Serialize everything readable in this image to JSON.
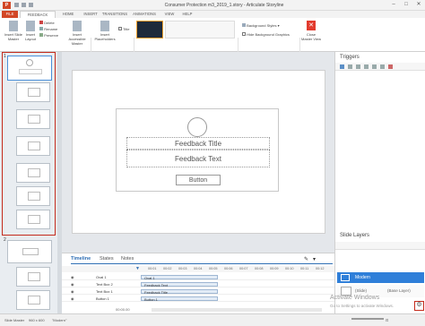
{
  "app": {
    "logo": "P",
    "window_title": "Consumer Protection m3_2019_1.story - Articulate Storyline",
    "min": "–",
    "max": "□",
    "close": "✕"
  },
  "tabs": [
    "FILE",
    "FEEDBACK MASTER",
    "HOME",
    "INSERT",
    "TRANSITIONS",
    "ANIMATIONS",
    "VIEW",
    "HELP"
  ],
  "ribbon": {
    "insert_slide_master": "Insert Slide Master",
    "insert_layout": "Insert Layout",
    "delete": "Delete",
    "rename": "Rename",
    "preserve": "Preserve",
    "insert_placeholder": "Insert Placeholders",
    "title": "Title",
    "insert_accessible_master": "Insert Accessible Master",
    "background_styles": "Background Styles",
    "hide_background_graphics": "Hide Background Graphics",
    "close_master_view": "Close Master View",
    "groups": {
      "edit_master": "Edit Master",
      "master_layout": "Master Layout",
      "theme_preview": "Theme Preview",
      "background": "Background",
      "close": "Close"
    }
  },
  "thumbnails": {
    "group1": "1",
    "group2": "2"
  },
  "slide": {
    "feedback_title": "Feedback Title",
    "feedback_text": "Feedback Text",
    "button": "Button"
  },
  "timeline": {
    "tabs": [
      "Timeline",
      "States",
      "Notes"
    ],
    "ticks": [
      "00:01",
      "00:02",
      "00:03",
      "00:04",
      "00:05",
      "00:06",
      "00:07",
      "00:08",
      "00:09",
      "00:10",
      "00:11",
      "00:12"
    ],
    "rows": [
      {
        "name": "Oval 1",
        "label": "Oval 1"
      },
      {
        "name": "Text Box 2",
        "label": "Feedback Text"
      },
      {
        "name": "Text Box 1",
        "label": "Feedback Title"
      },
      {
        "name": "Button 1",
        "label": "Button 1"
      }
    ],
    "time": "00:00.00"
  },
  "right_panel": {
    "triggers": "Triggers",
    "slide_layers": "Slide Layers",
    "modern": "Modern",
    "base_layer": "(Base Layer)",
    "base_name": "(Slide)",
    "watermark_title": "Activate Windows",
    "watermark_sub": "Go to Settings to activate Windows."
  },
  "status": {
    "view": "Slide Master",
    "dims": "960 x 600",
    "theme": "\"Modern\""
  },
  "colors": {
    "accent": "#d24726",
    "selection": "#c42b1c",
    "modern_layer": "#2f7fd9"
  }
}
